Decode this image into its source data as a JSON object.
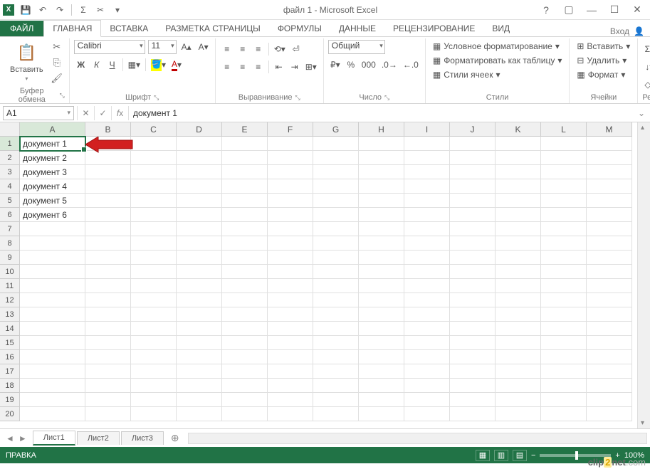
{
  "title": "файл 1 - Microsoft Excel",
  "qat": {
    "save": "💾",
    "undo": "↶",
    "redo": "↷",
    "sum": "Σ",
    "cut": "✂"
  },
  "tabs": {
    "file": "ФАЙЛ",
    "items": [
      "ГЛАВНАЯ",
      "ВСТАВКА",
      "РАЗМЕТКА СТРАНИЦЫ",
      "ФОРМУЛЫ",
      "ДАННЫЕ",
      "РЕЦЕНЗИРОВАНИЕ",
      "ВИД"
    ],
    "login": "Вход"
  },
  "ribbon": {
    "clipboard": {
      "paste": "Вставить",
      "label": "Буфер обмена"
    },
    "font": {
      "name": "Calibri",
      "size": "11",
      "bold": "Ж",
      "italic": "К",
      "underline": "Ч",
      "label": "Шрифт"
    },
    "align": {
      "label": "Выравнивание"
    },
    "number": {
      "format": "Общий",
      "label": "Число"
    },
    "styles": {
      "cond": "Условное форматирование",
      "table": "Форматировать как таблицу",
      "cell": "Стили ячеек",
      "label": "Стили"
    },
    "cells": {
      "insert": "Вставить",
      "delete": "Удалить",
      "format": "Формат",
      "label": "Ячейки"
    },
    "editing": {
      "label": "Редактирование"
    }
  },
  "formula_bar": {
    "name_box": "A1",
    "value": "документ 1"
  },
  "columns": [
    "A",
    "B",
    "C",
    "D",
    "E",
    "F",
    "G",
    "H",
    "I",
    "J",
    "K",
    "L",
    "M"
  ],
  "rows": [
    1,
    2,
    3,
    4,
    5,
    6,
    7,
    8,
    9,
    10,
    11,
    12,
    13,
    14,
    15,
    16,
    17,
    18,
    19,
    20
  ],
  "cell_data": {
    "r1": "документ 1",
    "r2": "документ 2",
    "r3": "документ 3",
    "r4": "документ 4",
    "r5": "документ 5",
    "r6": "документ 6"
  },
  "sheets": [
    "Лист1",
    "Лист2",
    "Лист3"
  ],
  "status": {
    "mode": "ПРАВКА",
    "zoom": "100%"
  },
  "watermark": {
    "a": "clip",
    "b": "2",
    "c": "net",
    "d": ".com"
  }
}
